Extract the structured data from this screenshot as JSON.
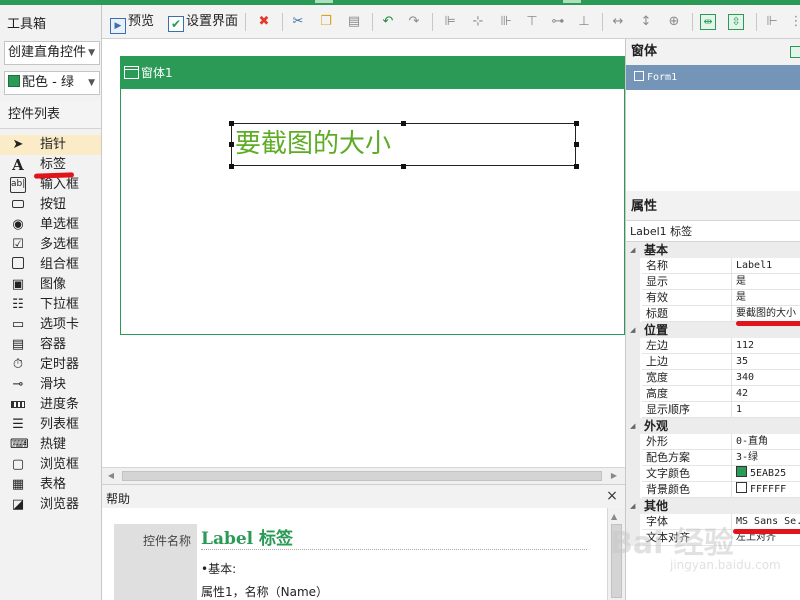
{
  "toolbox": {
    "title": "工具箱",
    "create_combo": "创建直角控件",
    "color_combo": "配色 - 绿",
    "list_title": "控件列表",
    "items": [
      {
        "label": "指针",
        "icon": "pointer-icon"
      },
      {
        "label": "标签",
        "icon": "label-a-icon"
      },
      {
        "label": "输入框",
        "icon": "textbox-icon"
      },
      {
        "label": "按钮",
        "icon": "button-icon"
      },
      {
        "label": "单选框",
        "icon": "radio-icon"
      },
      {
        "label": "多选框",
        "icon": "checkbox-icon"
      },
      {
        "label": "组合框",
        "icon": "groupbox-icon"
      },
      {
        "label": "图像",
        "icon": "image-icon"
      },
      {
        "label": "下拉框",
        "icon": "dropdown-icon"
      },
      {
        "label": "选项卡",
        "icon": "tab-icon"
      },
      {
        "label": "容器",
        "icon": "container-icon"
      },
      {
        "label": "定时器",
        "icon": "timer-icon"
      },
      {
        "label": "滑块",
        "icon": "slider-icon"
      },
      {
        "label": "进度条",
        "icon": "progressbar-icon"
      },
      {
        "label": "列表框",
        "icon": "listbox-icon"
      },
      {
        "label": "热键",
        "icon": "hotkey-icon"
      },
      {
        "label": "浏览框",
        "icon": "browsebox-icon"
      },
      {
        "label": "表格",
        "icon": "table-icon"
      },
      {
        "label": "浏览器",
        "icon": "browser-icon"
      }
    ]
  },
  "toolbar": {
    "preview_label": "预览",
    "design_label": "设置界面"
  },
  "design": {
    "window_title": "窗体1",
    "label_text": "要截图的大小",
    "label_color": "#5EAB25"
  },
  "help": {
    "title": "帮助",
    "close": "×",
    "key_label": "控件名称",
    "heading": "Label 标签",
    "line1": "•基本:",
    "line2": "属性1，名称（Name）"
  },
  "right": {
    "windows_title": "窗体",
    "window_item": "Form1",
    "props_title": "属性",
    "selected": "Label1 标签",
    "rows": [
      {
        "type": "cat",
        "label": "基本"
      },
      {
        "type": "prop",
        "key": "名称",
        "value": "Label1"
      },
      {
        "type": "prop",
        "key": "显示",
        "value": "是"
      },
      {
        "type": "prop",
        "key": "有效",
        "value": "是"
      },
      {
        "type": "prop",
        "key": "标题",
        "value": "要截图的大小"
      },
      {
        "type": "cat",
        "label": "位置"
      },
      {
        "type": "prop",
        "key": "左边",
        "value": "112"
      },
      {
        "type": "prop",
        "key": "上边",
        "value": "35"
      },
      {
        "type": "prop",
        "key": "宽度",
        "value": "340"
      },
      {
        "type": "prop",
        "key": "高度",
        "value": "42"
      },
      {
        "type": "prop",
        "key": "显示顺序",
        "value": "1"
      },
      {
        "type": "cat",
        "label": "外观"
      },
      {
        "type": "prop",
        "key": "外形",
        "value": "0-直角"
      },
      {
        "type": "prop",
        "key": "配色方案",
        "value": "3-绿"
      },
      {
        "type": "prop",
        "key": "文字颜色",
        "value": "5EAB25",
        "swatch": "#2a9a56"
      },
      {
        "type": "prop",
        "key": "背景颜色",
        "value": "FFFFFF",
        "swatch": "#ffffff"
      },
      {
        "type": "cat",
        "label": "其他"
      },
      {
        "type": "prop",
        "key": "字体",
        "value": "MS Sans Se..."
      },
      {
        "type": "prop",
        "key": "文本对齐",
        "value": "左上对齐"
      }
    ]
  },
  "watermark": {
    "logo": "Bai 经验",
    "url": "jingyan.baidu.com"
  },
  "colors": {
    "accent": "#2a9a56",
    "selection": "#7494b8",
    "highlight": "#fcebc7",
    "annotation": "#e2141b"
  }
}
